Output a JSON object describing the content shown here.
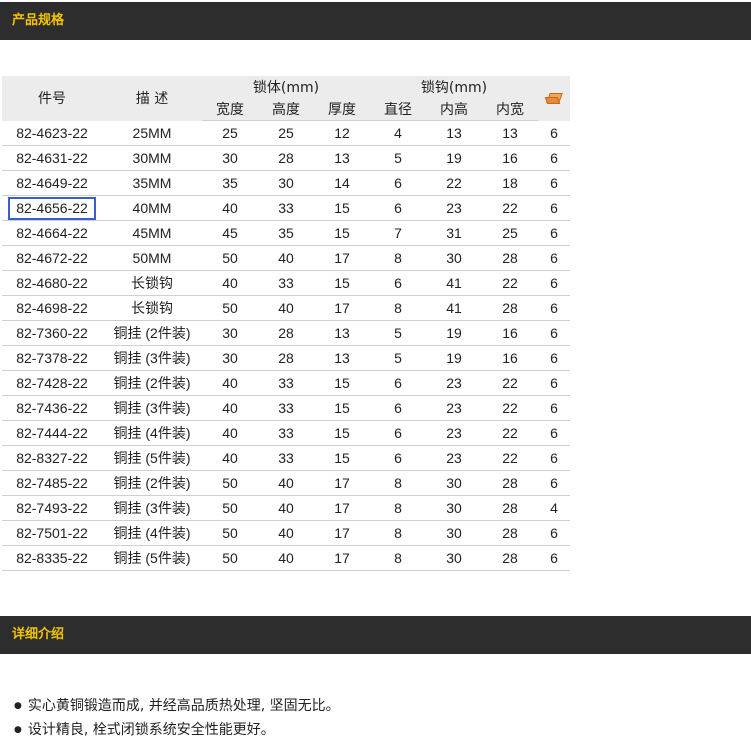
{
  "sections": {
    "specs_title": "产品规格",
    "details_title": "详细介绍"
  },
  "table": {
    "headers": {
      "part_no": "件号",
      "desc": "描 述",
      "lock_body": "锁体(mm)",
      "shackle": "锁钩(mm)",
      "width": "宽度",
      "height": "高度",
      "thickness": "厚度",
      "diameter": "直径",
      "inner_height": "内高",
      "inner_width": "内宽",
      "qty_icon": "box-icon"
    },
    "rows": [
      [
        "82-4623-22",
        "25MM",
        "25",
        "25",
        "12",
        "4",
        "13",
        "13",
        "6"
      ],
      [
        "82-4631-22",
        "30MM",
        "30",
        "28",
        "13",
        "5",
        "19",
        "16",
        "6"
      ],
      [
        "82-4649-22",
        "35MM",
        "35",
        "30",
        "14",
        "6",
        "22",
        "18",
        "6"
      ],
      [
        "82-4656-22",
        "40MM",
        "40",
        "33",
        "15",
        "6",
        "23",
        "22",
        "6"
      ],
      [
        "82-4664-22",
        "45MM",
        "45",
        "35",
        "15",
        "7",
        "31",
        "25",
        "6"
      ],
      [
        "82-4672-22",
        "50MM",
        "50",
        "40",
        "17",
        "8",
        "30",
        "28",
        "6"
      ],
      [
        "82-4680-22",
        "长锁钩",
        "40",
        "33",
        "15",
        "6",
        "41",
        "22",
        "6"
      ],
      [
        "82-4698-22",
        "长锁钩",
        "50",
        "40",
        "17",
        "8",
        "41",
        "28",
        "6"
      ],
      [
        "82-7360-22",
        "铜挂 (2件装)",
        "30",
        "28",
        "13",
        "5",
        "19",
        "16",
        "6"
      ],
      [
        "82-7378-22",
        "铜挂 (3件装)",
        "30",
        "28",
        "13",
        "5",
        "19",
        "16",
        "6"
      ],
      [
        "82-7428-22",
        "铜挂 (2件装)",
        "40",
        "33",
        "15",
        "6",
        "23",
        "22",
        "6"
      ],
      [
        "82-7436-22",
        "铜挂 (3件装)",
        "40",
        "33",
        "15",
        "6",
        "23",
        "22",
        "6"
      ],
      [
        "82-7444-22",
        "铜挂 (4件装)",
        "40",
        "33",
        "15",
        "6",
        "23",
        "22",
        "6"
      ],
      [
        "82-8327-22",
        "铜挂 (5件装)",
        "40",
        "33",
        "15",
        "6",
        "23",
        "22",
        "6"
      ],
      [
        "82-7485-22",
        "铜挂 (2件装)",
        "50",
        "40",
        "17",
        "8",
        "30",
        "28",
        "6"
      ],
      [
        "82-7493-22",
        "铜挂 (3件装)",
        "50",
        "40",
        "17",
        "8",
        "30",
        "28",
        "4"
      ],
      [
        "82-7501-22",
        "铜挂 (4件装)",
        "50",
        "40",
        "17",
        "8",
        "30",
        "28",
        "6"
      ],
      [
        "82-8335-22",
        "铜挂 (5件装)",
        "50",
        "40",
        "17",
        "8",
        "30",
        "28",
        "6"
      ]
    ],
    "highlighted_part": "82-4656-22",
    "highlight_color": "#3a5fc8"
  },
  "details": {
    "bullets": [
      "实心黄铜锻造而成, 并经高品质热处理, 坚固无比。",
      "设计精良, 栓式闭锁系统安全性能更好。"
    ]
  }
}
